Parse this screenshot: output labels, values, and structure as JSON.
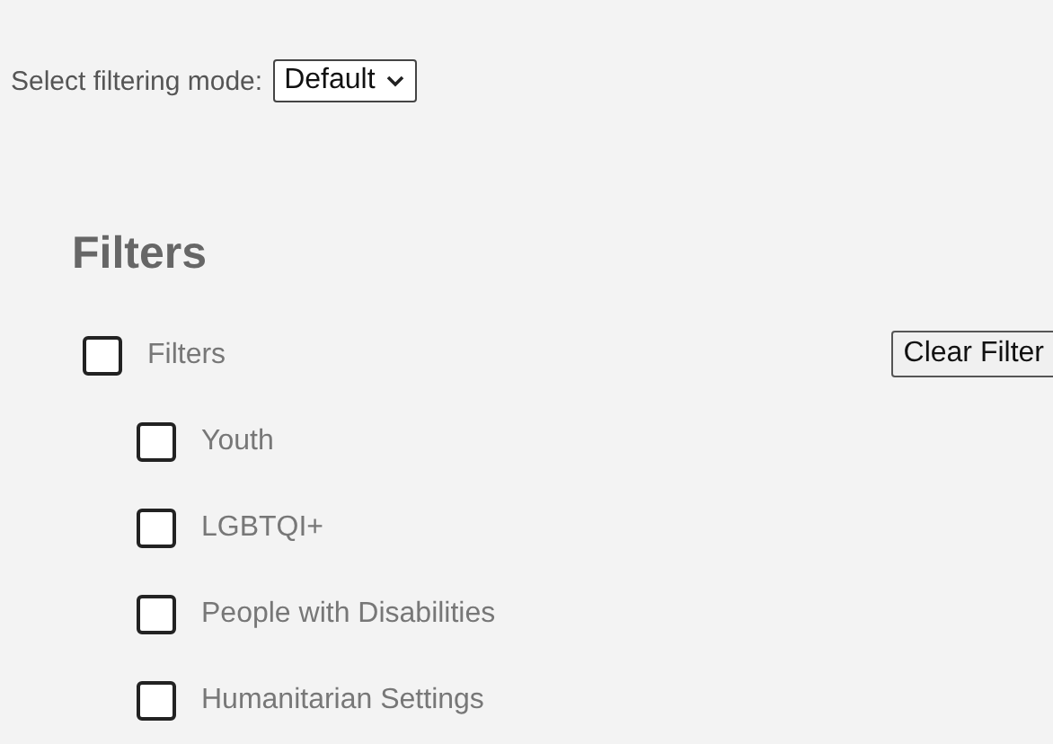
{
  "mode_selector": {
    "label": "Select filtering mode:",
    "value": "Default"
  },
  "heading": "Filters",
  "filters": [
    {
      "label": "Filters",
      "checked": false,
      "children": [
        {
          "label": "Youth",
          "checked": false
        },
        {
          "label": "LGBTQI+",
          "checked": false
        },
        {
          "label": "People with Disabilities",
          "checked": false
        },
        {
          "label": "Humanitarian Settings",
          "checked": false
        }
      ]
    }
  ],
  "clear_button": "Clear Filter"
}
